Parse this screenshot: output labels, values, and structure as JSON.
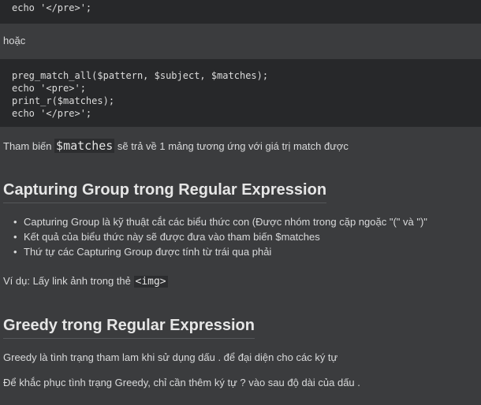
{
  "code_block_1": {
    "lines": [
      "echo '</pre>';"
    ]
  },
  "or_text": "hoặc",
  "code_block_2": {
    "lines": [
      "preg_match_all($pattern, $subject, $matches);",
      "echo '<pre>';",
      "print_r($matches);",
      "echo '</pre>';"
    ]
  },
  "matches_para": {
    "before": "Tham biến ",
    "code": "$matches",
    "after": " sẽ trả về 1 mảng tương ứng với giá trị match được"
  },
  "section_capturing": {
    "heading": "Capturing Group trong Regular Expression",
    "bullets": [
      "Capturing Group là kỹ thuật cắt các biểu thức con (Được nhóm trong cặp ngoặc \"(\" và \")\"",
      "Kết quả của biểu thức này sẽ được đưa vào tham biến $matches",
      "Thứ tự các Capturing Group được tính từ trái qua phải"
    ],
    "example": {
      "before": "Ví dụ: Lấy link ảnh trong thẻ ",
      "code": "<img>"
    }
  },
  "section_greedy": {
    "heading": "Greedy trong Regular Expression",
    "para1": "Greedy là tình trạng tham lam khi sử dụng dấu . để đại diện cho các ký tự",
    "para2": "Để khắc phục tình trạng Greedy, chỉ cần thêm ký tự ? vào sau độ dài của dấu ."
  }
}
